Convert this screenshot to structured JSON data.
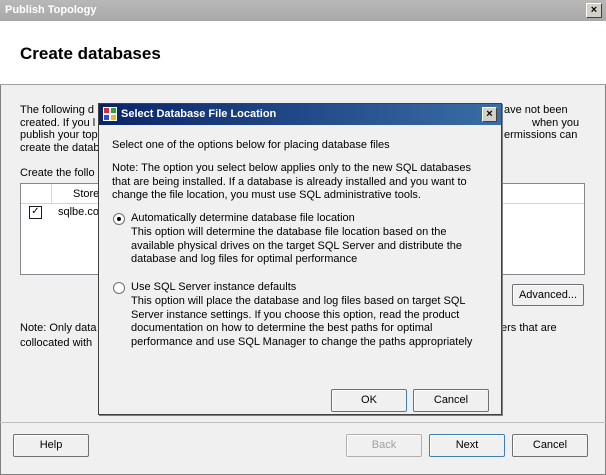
{
  "window": {
    "title": "Publish Topology"
  },
  "header": {
    "title": "Create databases"
  },
  "background": {
    "para_lines": [
      [
        "The following d",
        "ave not been"
      ],
      [
        "created. If you l",
        "when you"
      ],
      [
        "publish your top",
        "ermissions can"
      ],
      [
        "create the datab",
        ""
      ]
    ],
    "list_label": "Create the follo",
    "list_col_header": "Store",
    "list_row_text": "sqlbe.co",
    "note_line1_left": "Note: Only data",
    "note_line1_right": "ers that are",
    "note_line2_left": "collocated with"
  },
  "buttons": {
    "advanced": "Advanced...",
    "help": "Help",
    "back": "Back",
    "next": "Next",
    "cancel": "Cancel"
  },
  "dialog": {
    "title": "Select Database File Location",
    "intro": "Select one of the options below for placing database files",
    "note_lines": [
      "Note: The option you select below applies only to the new SQL databases",
      "that are being installed. If a database is already installed and you want to",
      "change the file location, you must use SQL administrative tools."
    ],
    "option1": {
      "label": "Automatically determine database file location",
      "selected": true,
      "desc_lines": [
        "This option will determine the database file location based on the",
        "available physical drives on the target SQL Server and distribute the",
        "database and log files for optimal performance"
      ]
    },
    "option2": {
      "label": "Use SQL Server instance defaults",
      "selected": false,
      "desc_lines": [
        "This option will place the database and log files based on target SQL",
        "Server instance settings. If you choose this option, read the product",
        "documentation on how to determine the best paths for optimal",
        "performance and use SQL Manager to change the paths appropriately"
      ]
    },
    "ok_label": "OK",
    "cancel_label": "Cancel"
  }
}
